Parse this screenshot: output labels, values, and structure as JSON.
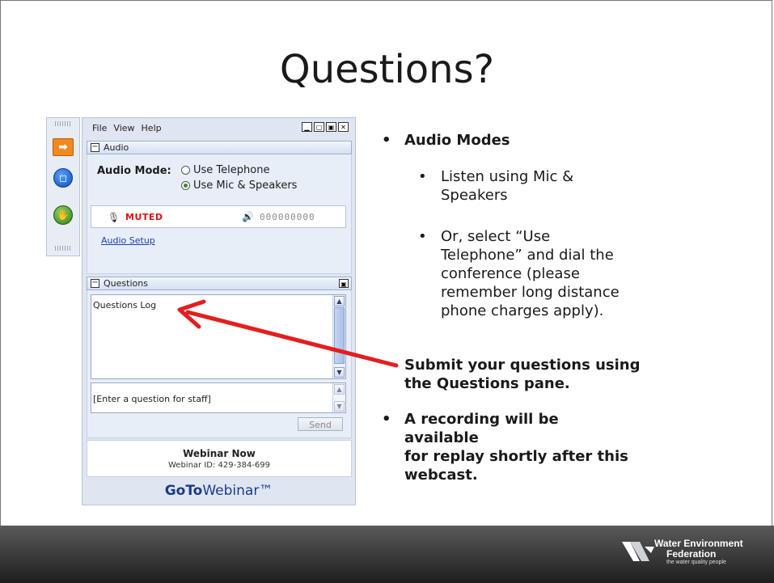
{
  "slide": {
    "title": "Questions?"
  },
  "app": {
    "menu": [
      "File",
      "View",
      "Help"
    ],
    "window_controls": [
      "▁",
      "▢",
      "▣",
      "✕"
    ],
    "audio_section": {
      "header": "Audio",
      "mode_label": "Audio Mode:",
      "options": [
        {
          "label": "Use Telephone",
          "selected": false
        },
        {
          "label": "Use Mic & Speakers",
          "selected": true
        }
      ],
      "status": "MUTED",
      "speaker_code": "000000000",
      "setup_link": "Audio Setup"
    },
    "questions_section": {
      "header": "Questions",
      "log_label": "Questions Log",
      "input_value": "[Enter a question for staff]",
      "send_label": "Send"
    },
    "footer": {
      "title": "Webinar Now",
      "webinar_id": "Webinar ID: 429-384-699",
      "brand_bold": "GoTo",
      "brand_rest": "Webinar™"
    }
  },
  "bullets": [
    {
      "level": 1,
      "text": "Audio Modes"
    },
    {
      "level": 2,
      "lines": [
        "Listen using Mic &",
        "Speakers"
      ]
    },
    {
      "level": 2,
      "lines": [
        "Or, select “Use",
        "Telephone” and dial the",
        "conference (please",
        "remember long distance",
        "phone charges apply)."
      ]
    },
    {
      "level": 1,
      "lines": [
        "Submit your questions using",
        "the Questions pane."
      ]
    },
    {
      "level": 1,
      "lines": [
        "A recording will be",
        "available",
        "for replay shortly after this",
        "webcast."
      ]
    }
  ],
  "branding": {
    "line1": "Water Environment",
    "line2": "Federation",
    "tagline": "the water quality people"
  },
  "colors": {
    "arrow": "#e41e1e",
    "footer_band": "#2b2b2b",
    "accent_orange": "#f08a1e"
  }
}
